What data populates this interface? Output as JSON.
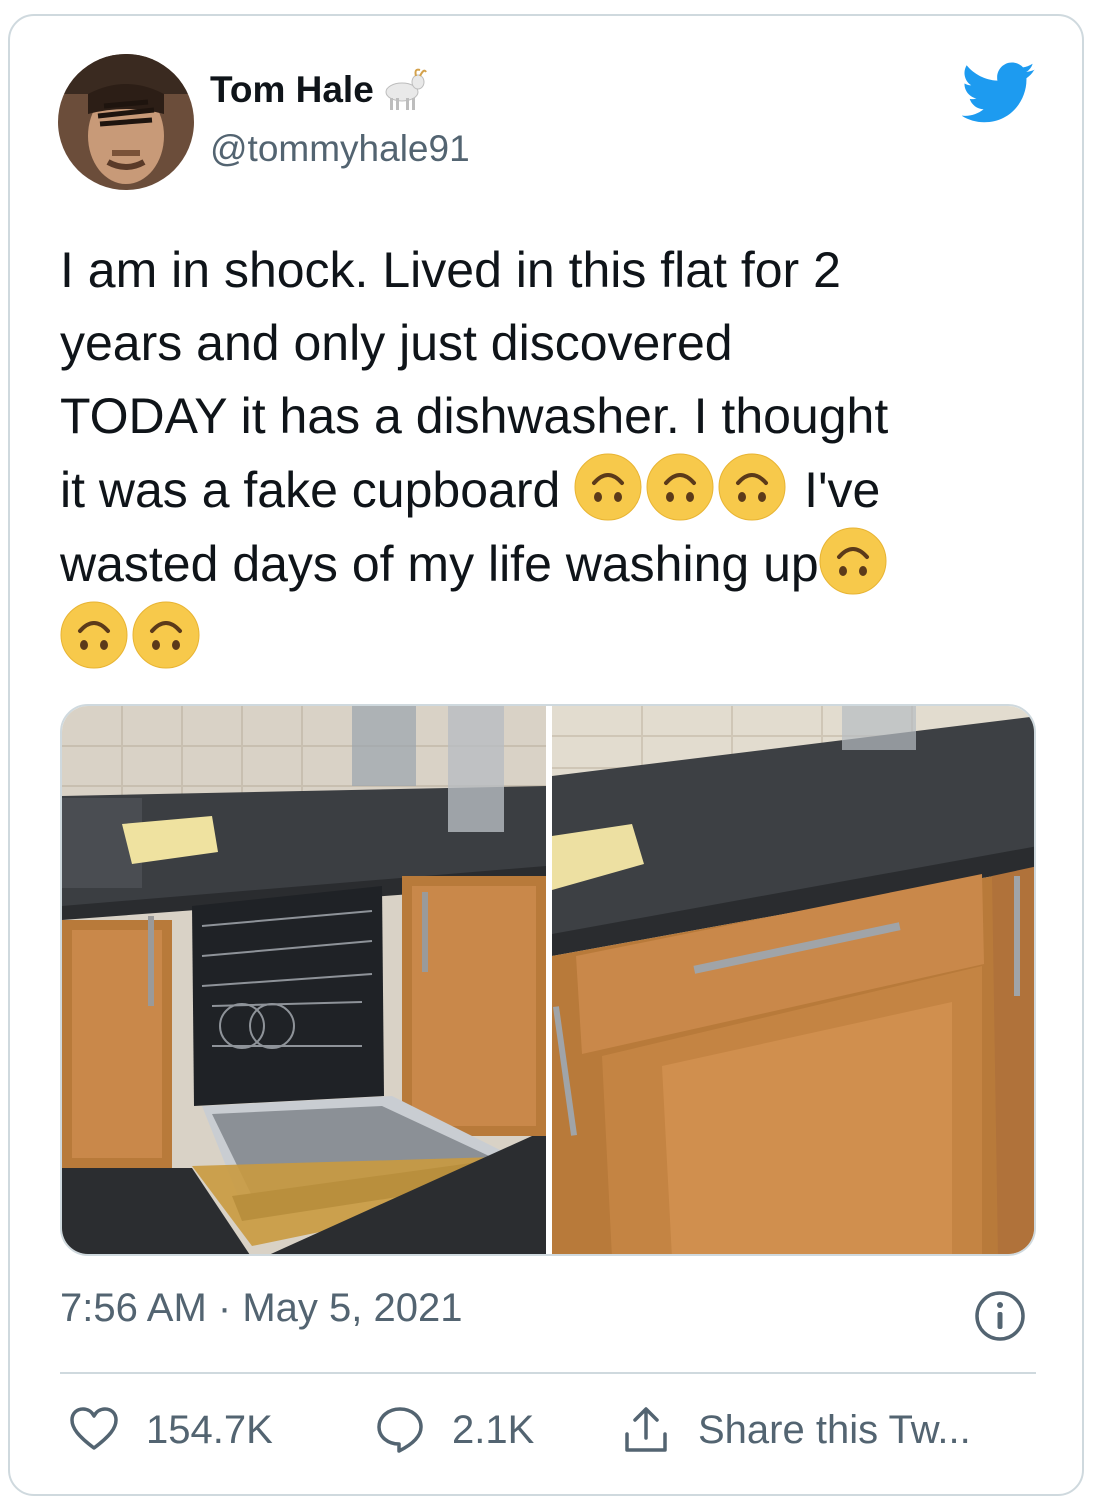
{
  "user": {
    "display_name": "Tom Hale",
    "handle": "@tommyhale91",
    "badge_icon": "goat-emoji-icon",
    "avatar_icon": "user-avatar"
  },
  "brand_icon": "twitter-bird-icon",
  "tweet": {
    "line1": "I am in shock. Lived in this flat for 2",
    "line2": "years and only just discovered",
    "line3": "TODAY it has a dishwasher. I thought",
    "line4a": "it was a fake cupboard",
    "line4b": "I've",
    "line5": "wasted days of my life washing up",
    "emoji_icon": "upside-down-face-emoji-icon"
  },
  "media": {
    "left_photo": "open-dishwasher-photo",
    "right_photo": "closed-cupboard-photo"
  },
  "meta": {
    "time": "7:56 AM",
    "separator": "·",
    "date": "May 5, 2021"
  },
  "actions": {
    "likes": "154.7K",
    "replies": "2.1K",
    "share_label": "Share this Tw..."
  },
  "colors": {
    "twitter_blue": "#1d9bf0",
    "text_primary": "#0f1419",
    "text_secondary": "#536471",
    "border": "#cfd9de",
    "emoji_yellow": "#f7c94b"
  }
}
